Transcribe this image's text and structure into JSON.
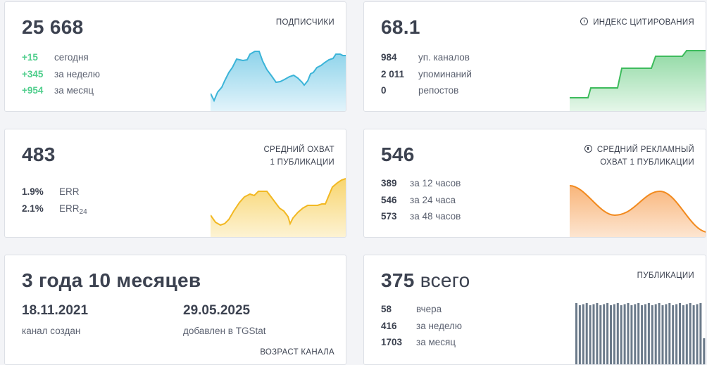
{
  "subscribers": {
    "value": "25 668",
    "label": "ПОДПИСЧИКИ",
    "stats": [
      {
        "value": "+15",
        "label": "сегодня"
      },
      {
        "value": "+345",
        "label": "за неделю"
      },
      {
        "value": "+954",
        "label": "за месяц"
      }
    ],
    "color": "#3bb4d8"
  },
  "citation": {
    "value": "68.1",
    "label": "ИНДЕКС ЦИТИРОВАНИЯ",
    "stats": [
      {
        "value": "984",
        "label": "уп. каналов"
      },
      {
        "value": "2 011",
        "label": "упоминаний"
      },
      {
        "value": "0",
        "label": "репостов"
      }
    ],
    "color": "#3dbb5c"
  },
  "reach": {
    "value": "483",
    "label_line1": "СРЕДНИЙ ОХВАТ",
    "label_line2": "1 ПУБЛИКАЦИИ",
    "err": {
      "value": "1.9%",
      "label": "ERR"
    },
    "err24": {
      "value": "2.1%",
      "label": "ERR",
      "sub": "24"
    },
    "color": "#f2b822"
  },
  "ad_reach": {
    "value": "546",
    "label_line1": "СРЕДНИЙ РЕКЛАМНЫЙ",
    "label_line2": "ОХВАТ 1 ПУБЛИКАЦИИ",
    "stats": [
      {
        "value": "389",
        "label": "за 12 часов"
      },
      {
        "value": "546",
        "label": "за 24 часа"
      },
      {
        "value": "573",
        "label": "за 48 часов"
      }
    ],
    "color": "#f28a1e"
  },
  "age": {
    "value": "3 года 10 месяцев",
    "created": {
      "date": "18.11.2021",
      "label": "канал создан"
    },
    "added": {
      "date": "29.05.2025",
      "label": "добавлен в TGStat"
    },
    "label": "ВОЗРАСТ КАНАЛА"
  },
  "publications": {
    "value": "375",
    "suffix": "всего",
    "label": "ПУБЛИКАЦИИ",
    "stats": [
      {
        "value": "58",
        "label": "вчера"
      },
      {
        "value": "416",
        "label": "за неделю"
      },
      {
        "value": "1703",
        "label": "за месяц"
      }
    ],
    "color": "#6b7a8a"
  }
}
